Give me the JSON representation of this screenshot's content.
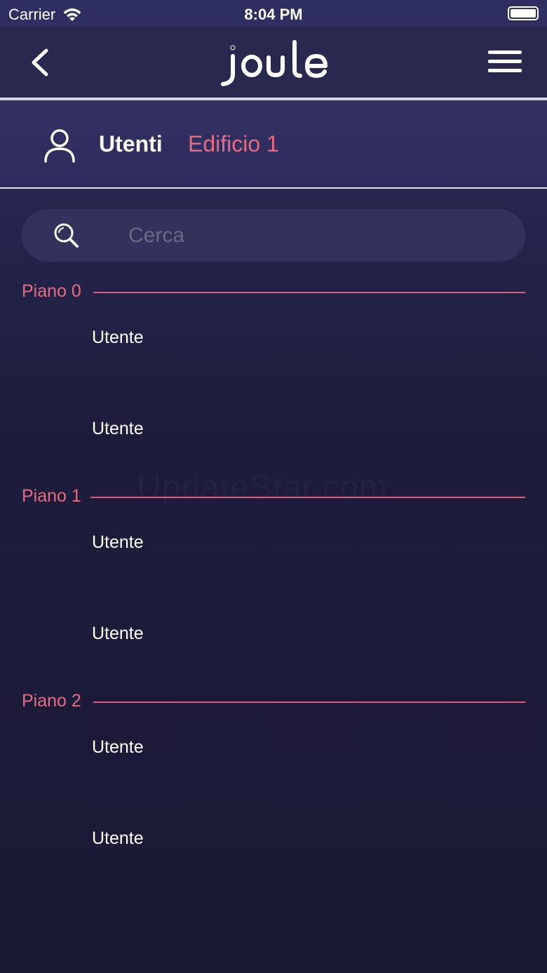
{
  "status_bar": {
    "carrier": "Carrier",
    "time": "8:04 PM"
  },
  "nav": {
    "logo_text": "joule",
    "back_icon": "chevron-left-icon",
    "menu_icon": "hamburger-menu-icon"
  },
  "header": {
    "title": "Utenti",
    "subtitle": "Edificio 1",
    "icon": "user-icon"
  },
  "search": {
    "placeholder": "Cerca",
    "value": ""
  },
  "floors": [
    {
      "label": "Piano 0",
      "users": [
        "Utente",
        "Utente"
      ]
    },
    {
      "label": "Piano 1",
      "users": [
        "Utente",
        "Utente"
      ]
    },
    {
      "label": "Piano 2",
      "users": [
        "Utente",
        "Utente"
      ]
    }
  ],
  "watermark": "UpdateStar.com",
  "colors": {
    "accent": "#e96b80",
    "background": "#1d1c3c",
    "header": "#2d2c5c"
  }
}
